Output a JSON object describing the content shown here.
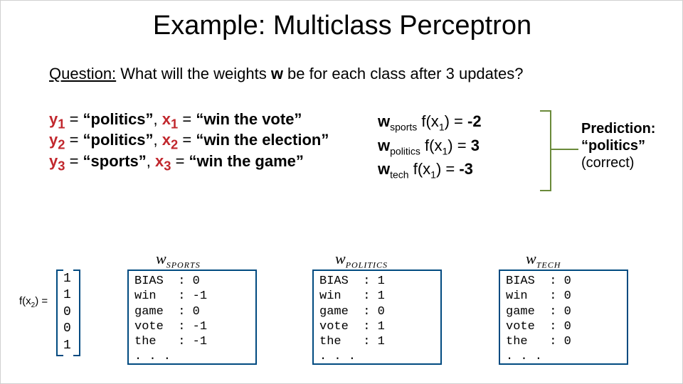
{
  "title": "Example: Multiclass Perceptron",
  "question": {
    "label": "Question:",
    "text_before_w": " What will the weights ",
    "w": "w",
    "text_after_w": " be for each class after 3 updates?"
  },
  "examples": [
    {
      "y_var": "y",
      "y_sub": "1",
      "y_eq": " = ",
      "y_val": "“politics”",
      "sep": ",  ",
      "x_var": "x",
      "x_sub": "1",
      "x_eq": " = ",
      "x_val": "“win the vote”"
    },
    {
      "y_var": "y",
      "y_sub": "2",
      "y_eq": " = ",
      "y_val": "“politics”",
      "sep": ",  ",
      "x_var": "x",
      "x_sub": "2",
      "x_eq": " = ",
      "x_val": "“win the election”"
    },
    {
      "y_var": "y",
      "y_sub": "3",
      "y_eq": " = ",
      "y_val": "“sports”",
      "sep": ",  ",
      "x_var": "x",
      "x_sub": "3",
      "x_eq": " = ",
      "x_val": "“win the game”"
    }
  ],
  "scores": [
    {
      "w": "w",
      "sub": "sports",
      "fx": " f(x",
      "fxsub": "1",
      "close": ") = ",
      "val": "-2"
    },
    {
      "w": "w",
      "sub": "politics",
      "fx": " f(x",
      "fxsub": "1",
      "close": ") = ",
      "val": "3"
    },
    {
      "w": "w",
      "sub": "tech",
      "fx": " f(x",
      "fxsub": "1",
      "close": ") = ",
      "val": "-3"
    }
  ],
  "prediction": {
    "title": "Prediction:",
    "value": "“politics”",
    "note": "(correct)"
  },
  "fx_label": {
    "f": "f(x",
    "sub": "2",
    "close": ") ="
  },
  "fx_vec": [
    "1",
    "1",
    "0",
    "0",
    "1"
  ],
  "weight_vectors": [
    {
      "label_w": "w",
      "label_sub": "SPORTS",
      "rows": [
        {
          "k": "BIAS",
          "v": "0"
        },
        {
          "k": "win",
          "v": "-1"
        },
        {
          "k": "game",
          "v": "0"
        },
        {
          "k": "vote",
          "v": "-1"
        },
        {
          "k": "the",
          "v": "-1"
        },
        {
          "k": ". . .",
          "v": ""
        }
      ]
    },
    {
      "label_w": "w",
      "label_sub": "POLITICS",
      "rows": [
        {
          "k": "BIAS",
          "v": "1"
        },
        {
          "k": "win",
          "v": "1"
        },
        {
          "k": "game",
          "v": "0"
        },
        {
          "k": "vote",
          "v": "1"
        },
        {
          "k": "the",
          "v": "1"
        },
        {
          "k": ". . .",
          "v": ""
        }
      ]
    },
    {
      "label_w": "w",
      "label_sub": "TECH",
      "rows": [
        {
          "k": "BIAS",
          "v": "0"
        },
        {
          "k": "win",
          "v": "0"
        },
        {
          "k": "game",
          "v": "0"
        },
        {
          "k": "vote",
          "v": "0"
        },
        {
          "k": "the",
          "v": "0"
        },
        {
          "k": ". . .",
          "v": ""
        }
      ]
    }
  ],
  "chart_data": {
    "type": "table",
    "title": "Multiclass perceptron weight vectors after processing x1",
    "features": [
      "BIAS",
      "win",
      "game",
      "vote",
      "the"
    ],
    "f_x2": [
      1,
      1,
      0,
      0,
      1
    ],
    "w_sports": [
      0,
      -1,
      0,
      -1,
      -1
    ],
    "w_politics": [
      1,
      1,
      0,
      1,
      1
    ],
    "w_tech": [
      0,
      0,
      0,
      0,
      0
    ],
    "scores_on_x1": {
      "sports": -2,
      "politics": 3,
      "tech": -3
    },
    "prediction_on_x1": "politics",
    "prediction_correct": true
  }
}
